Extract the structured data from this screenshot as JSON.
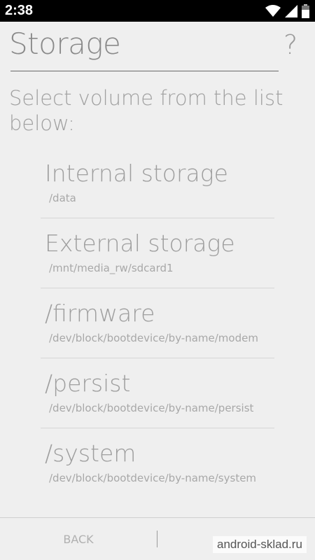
{
  "status_bar": {
    "time": "2:38",
    "icons": [
      "wifi-icon",
      "signal-icon",
      "battery-icon"
    ]
  },
  "header": {
    "title": "Storage",
    "help": "?"
  },
  "prompt": "Select volume from the list below:",
  "volumes": [
    {
      "name": "Internal storage",
      "path": "/data"
    },
    {
      "name": "External storage",
      "path": "/mnt/media_rw/sdcard1"
    },
    {
      "name": "/firmware",
      "path": "/dev/block/bootdevice/by-name/modem"
    },
    {
      "name": "/persist",
      "path": "/dev/block/bootdevice/by-name/persist"
    },
    {
      "name": "/system",
      "path": "/dev/block/bootdevice/by-name/system"
    }
  ],
  "footer": {
    "back": "BACK"
  },
  "watermark": "android-sklad.ru"
}
